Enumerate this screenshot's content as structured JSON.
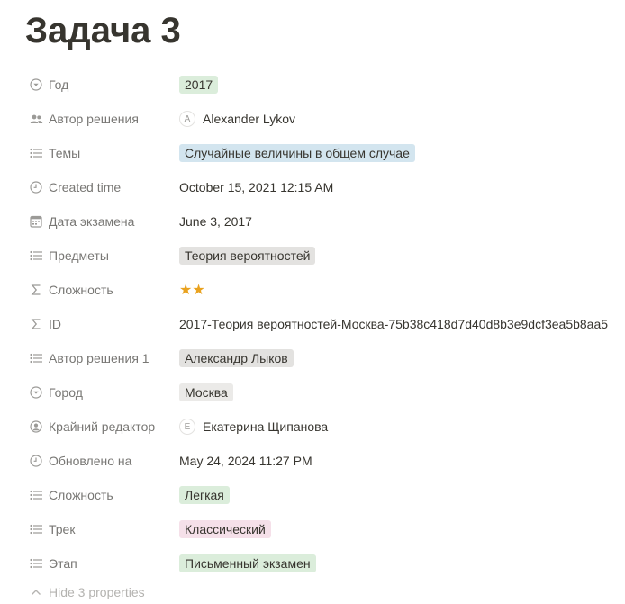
{
  "title": "Задача 3",
  "properties": [
    {
      "label": "Год",
      "value": "2017"
    },
    {
      "label": "Автор решения",
      "avatar": "A",
      "value": "Alexander Lykov"
    },
    {
      "label": "Темы",
      "value": "Случайные величины в общем случае"
    },
    {
      "label": "Created time",
      "value": "October 15, 2021 12:15 AM"
    },
    {
      "label": "Дата экзамена",
      "value": "June 3, 2017"
    },
    {
      "label": "Предметы",
      "value": "Теория вероятностей"
    },
    {
      "label": "Сложность",
      "value": "★★",
      "rating": 2
    },
    {
      "label": "ID",
      "value": "2017-Теория вероятностей-Москва-75b38c418d7d40d8b3e9dcf3ea5b8aa5"
    },
    {
      "label": "Автор решения 1",
      "value": "Александр Лыков"
    },
    {
      "label": "Город",
      "value": "Москва"
    },
    {
      "label": "Крайний редактор",
      "avatar": "E",
      "value": "Екатерина Щипанова"
    },
    {
      "label": "Обновлено на",
      "value": "May 24, 2024 11:27 PM"
    },
    {
      "label": "Сложность",
      "value": "Легкая"
    },
    {
      "label": "Трек",
      "value": "Классический"
    },
    {
      "label": "Этап",
      "value": "Письменный экзамен"
    }
  ],
  "hide_properties_label": "Hide 3 properties",
  "colors": {
    "tag_green": "#dbeddb",
    "tag_blue": "#d3e5ef",
    "tag_gray": "#e3e2e0",
    "tag_pink": "#f5e0e9",
    "star": "#e9a21f"
  }
}
